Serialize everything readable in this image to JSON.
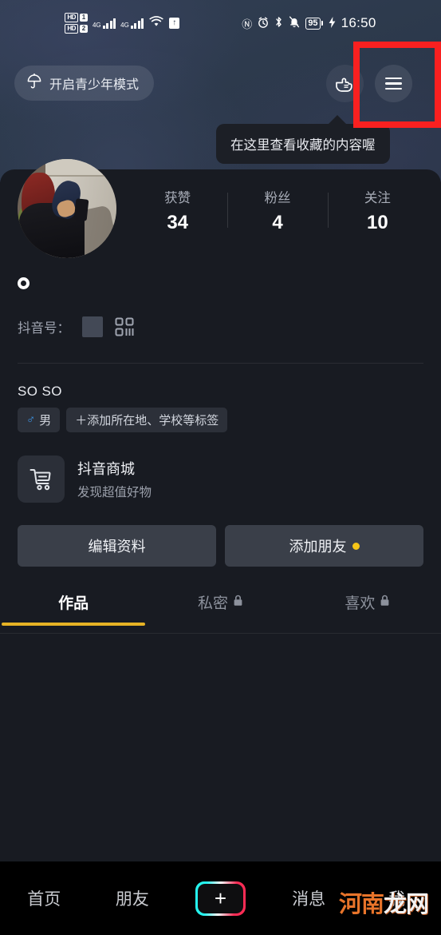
{
  "status_bar": {
    "hd_badge_1": "HD",
    "hd_badge_2": "HD",
    "sim_1": "1",
    "sim_2": "2",
    "network_1": "4G",
    "network_2": "4G",
    "icons": [
      "nfc-icon",
      "alarm-icon",
      "bluetooth-icon",
      "mute-bell-icon"
    ],
    "nfc_glyph": "Ⓝ",
    "alarm_glyph": "⏰",
    "bluetooth_glyph": "ᛦ",
    "bell_mute_glyph": "🔕",
    "battery_level": "95",
    "charging_glyph": "⚡",
    "time": "16:50"
  },
  "top_bar": {
    "youth_mode_label": "开启青少年模式",
    "youth_icon": "umbrella-icon",
    "hand_icon": "pointing-hand-icon",
    "menu_icon": "hamburger-menu-icon"
  },
  "tooltip": {
    "text": "在这里查看收藏的内容喔"
  },
  "annotation": {
    "color": "#f92020",
    "target": "hamburger-menu-icon"
  },
  "profile": {
    "avatar_alt": "user-avatar-photo",
    "stats": [
      {
        "label": "获赞",
        "value": "34"
      },
      {
        "label": "粉丝",
        "value": "4"
      },
      {
        "label": "关注",
        "value": "10"
      }
    ],
    "username": "",
    "douyin_id_label": "抖音号：",
    "douyin_id_value": "",
    "qr_icon": "qr-code-icon",
    "bio": "SO SO",
    "gender_tag": "男",
    "gender_symbol": "♂",
    "add_tag_label": "＋添加所在地、学校等标签"
  },
  "mall": {
    "icon": "shopping-cart-icon",
    "title": "抖音商城",
    "subtitle": "发现超值好物"
  },
  "actions": {
    "edit_profile_label": "编辑资料",
    "add_friend_label": "添加朋友",
    "add_friend_badge_color": "#f5c518"
  },
  "tabs": {
    "active_index": 0,
    "accent_color": "#e6b325",
    "items": [
      {
        "label": "作品",
        "locked": false,
        "lock_glyph": ""
      },
      {
        "label": "私密",
        "locked": true,
        "lock_glyph": "🔒"
      },
      {
        "label": "喜欢",
        "locked": true,
        "lock_glyph": "🔒"
      }
    ]
  },
  "bottom_nav": {
    "items": [
      {
        "label": "首页"
      },
      {
        "label": "朋友"
      },
      {
        "label": "+"
      },
      {
        "label": "消息"
      },
      {
        "label": "我"
      }
    ],
    "plus_glyph": "+"
  },
  "watermark": {
    "part1": "河南",
    "part2": "龙",
    "part3": "网"
  }
}
